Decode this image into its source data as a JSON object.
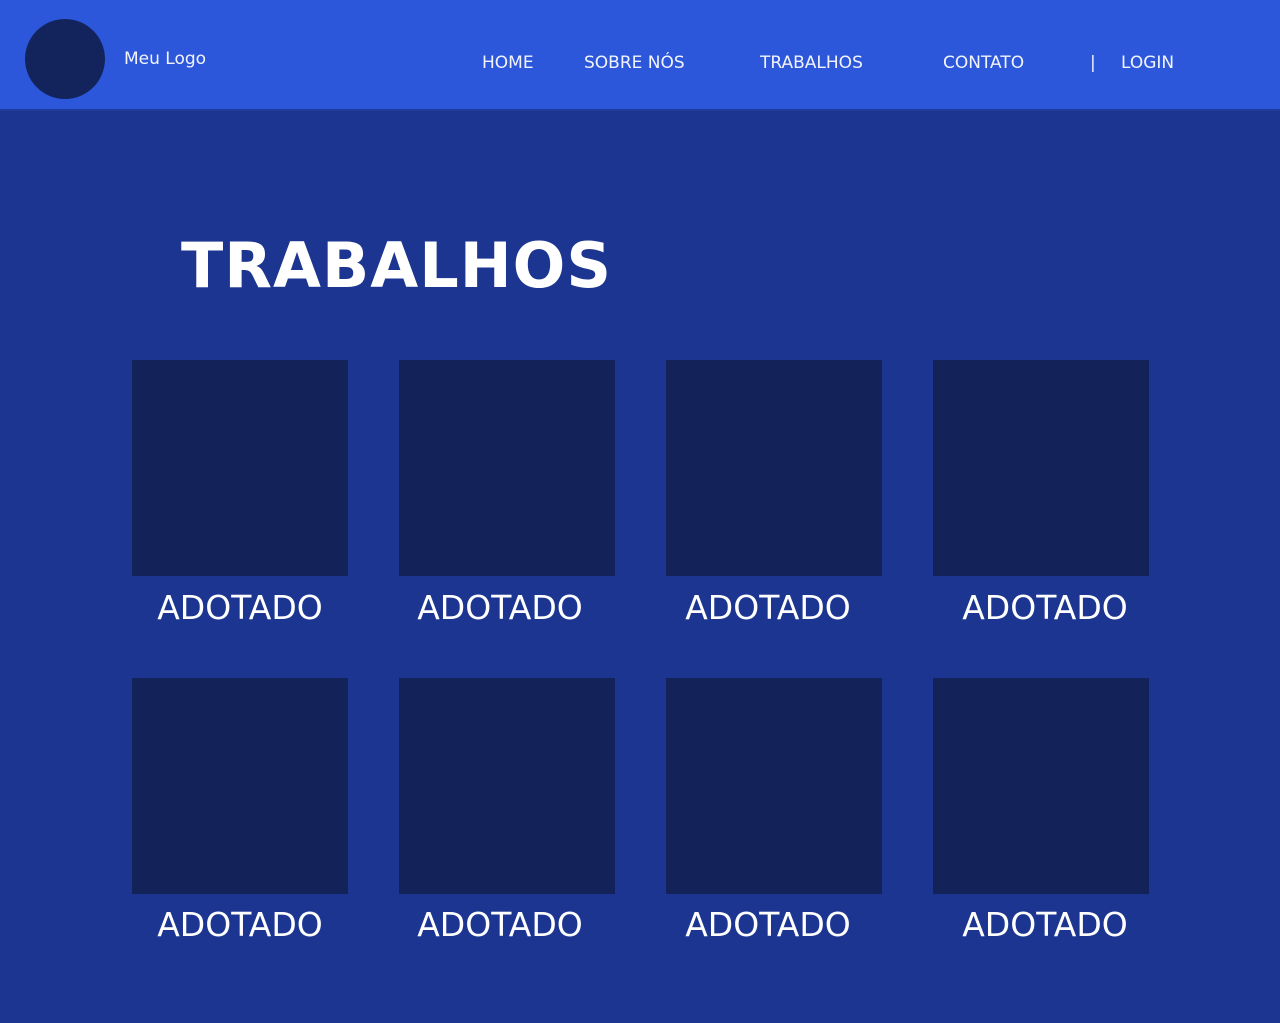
{
  "header": {
    "logo_text": "Meu Logo",
    "nav": [
      {
        "label": "HOME"
      },
      {
        "label": "SOBRE NÓS"
      },
      {
        "label": "TRABALHOS"
      },
      {
        "label": "CONTATO"
      }
    ],
    "separator": "|",
    "login_label": "LOGIN"
  },
  "main": {
    "title": "TRABALHOS",
    "cards": [
      {
        "label": "ADOTADO"
      },
      {
        "label": "ADOTADO"
      },
      {
        "label": "ADOTADO"
      },
      {
        "label": "ADOTADO"
      },
      {
        "label": "ADOTADO"
      },
      {
        "label": "ADOTADO"
      },
      {
        "label": "ADOTADO"
      },
      {
        "label": "ADOTADO"
      }
    ]
  },
  "colors": {
    "header_bg": "#2d57da",
    "page_bg": "#1c3590",
    "card_bg": "#13235a",
    "logo_circle": "#13235c",
    "text": "#ffffff"
  }
}
